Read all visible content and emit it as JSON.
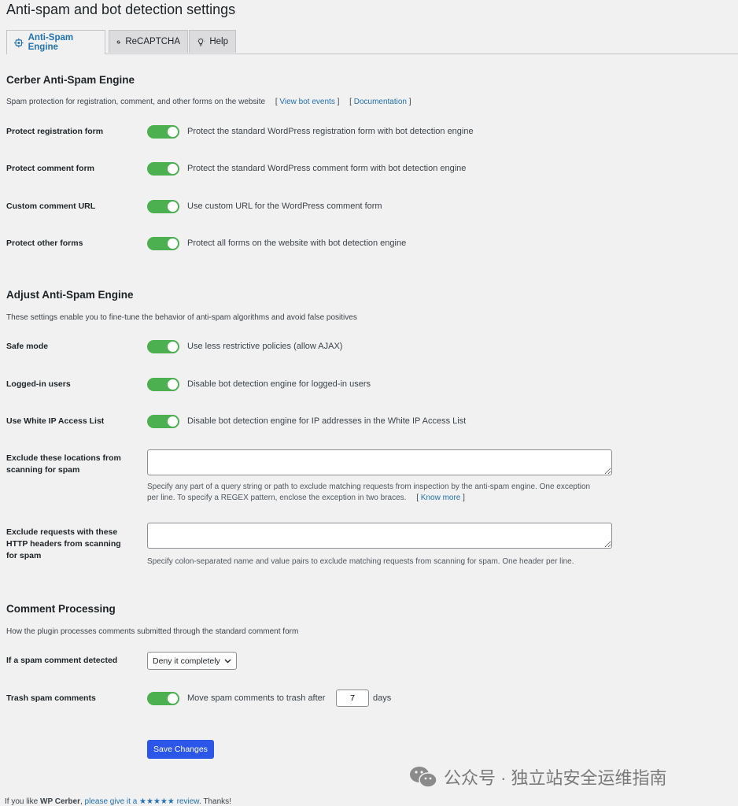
{
  "page": {
    "title": "Anti-spam and bot detection settings"
  },
  "tabs": [
    {
      "label": "Anti-Spam Engine",
      "active": true
    },
    {
      "label": "ReCAPTCHA",
      "active": false
    },
    {
      "label": "Help",
      "active": false
    }
  ],
  "section1": {
    "title": "Cerber Anti-Spam Engine",
    "desc": "Spam protection for registration, comment, and other forms on the website",
    "link1": "View bot events",
    "link2": "Documentation",
    "rows": [
      {
        "label": "Protect registration form",
        "text": "Protect the standard WordPress registration form with bot detection engine",
        "on": true
      },
      {
        "label": "Protect comment form",
        "text": "Protect the standard WordPress comment form with bot detection engine",
        "on": true
      },
      {
        "label": "Custom comment URL",
        "text": "Use custom URL for the WordPress comment form",
        "on": true
      },
      {
        "label": "Protect other forms",
        "text": "Protect all forms on the website with bot detection engine",
        "on": true
      }
    ]
  },
  "section2": {
    "title": "Adjust Anti-Spam Engine",
    "desc": "These settings enable you to fine-tune the behavior of anti-spam algorithms and avoid false positives",
    "rows": [
      {
        "label": "Safe mode",
        "text": "Use less restrictive policies (allow AJAX)",
        "on": true
      },
      {
        "label": "Logged-in users",
        "text": "Disable bot detection engine for logged-in users",
        "on": true
      },
      {
        "label": "Use White IP Access List",
        "text": "Disable bot detection engine for IP addresses in the White IP Access List",
        "on": true
      }
    ],
    "exclude_locations": {
      "label": "Exclude these locations from scanning for spam",
      "value": "",
      "help": "Specify any part of a query string or path to exclude matching requests from inspection by the anti-spam engine. One exception per line. To specify a REGEX pattern, enclose the exception in two braces.",
      "link": "Know more"
    },
    "exclude_headers": {
      "label": "Exclude requests with these HTTP headers from scanning for spam",
      "value": "",
      "help": "Specify colon-separated name and value pairs to exclude matching requests from scanning for spam. One header per line."
    }
  },
  "section3": {
    "title": "Comment Processing",
    "desc": "How the plugin processes comments submitted through the standard comment form",
    "spam_detected": {
      "label": "If a spam comment detected",
      "selected": "Deny it completely"
    },
    "trash": {
      "label": "Trash spam comments",
      "text": "Move spam comments to trash after",
      "days": "7",
      "suffix": "days",
      "on": true
    }
  },
  "save_label": "Save Changes",
  "watermark": "公众号 · 独立站安全运维指南",
  "footer": {
    "prefix": "If you like",
    "brand": "WP Cerber",
    "link": "please give it a ★★★★★ review",
    "suffix": "Thanks!"
  },
  "icons": {
    "tab1": "gear-chip-icon",
    "tab2": "google-g-icon",
    "tab3": "lightbulb-icon",
    "select": "chevron-down-icon",
    "watermark": "wechat-icon"
  },
  "colors": {
    "accent": "#2271b1",
    "toggle_on": "#4caf50",
    "button": "#2b56e8"
  }
}
